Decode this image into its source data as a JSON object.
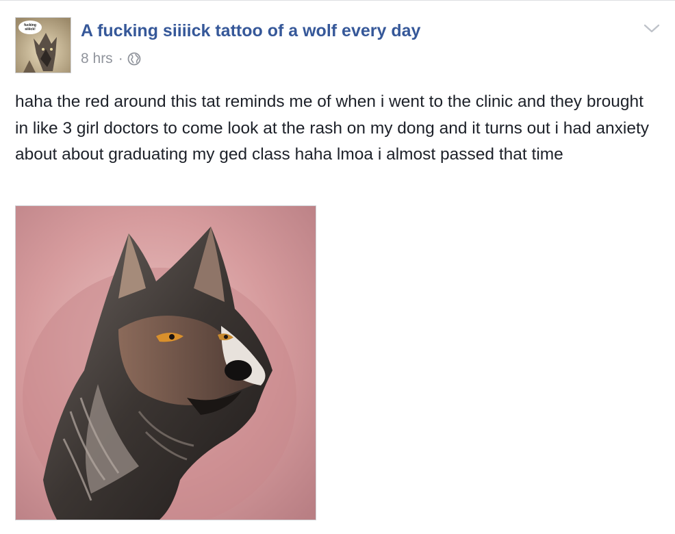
{
  "post": {
    "page_name": "A fucking siiiick tattoo of a wolf every day",
    "timestamp": "8 hrs",
    "separator": "·",
    "privacy_icon": "globe-icon",
    "avatar_badge_line1": "fucking",
    "avatar_badge_line2": "siiiick!",
    "text": "haha the red around this tat reminds me of when i went to the clinic and they brought in like 3 girl doctors to come look at the rash on my dong and it turns out i had anxiety about about graduating my ged class haha lmoa i almost passed that time",
    "options_icon": "chevron-down-icon",
    "image_subject": "wolf-tattoo"
  },
  "colors": {
    "link": "#365899",
    "meta": "#90949c",
    "body_text": "#1d2129",
    "background": "#ffffff",
    "skin_red": "#c98f93"
  }
}
